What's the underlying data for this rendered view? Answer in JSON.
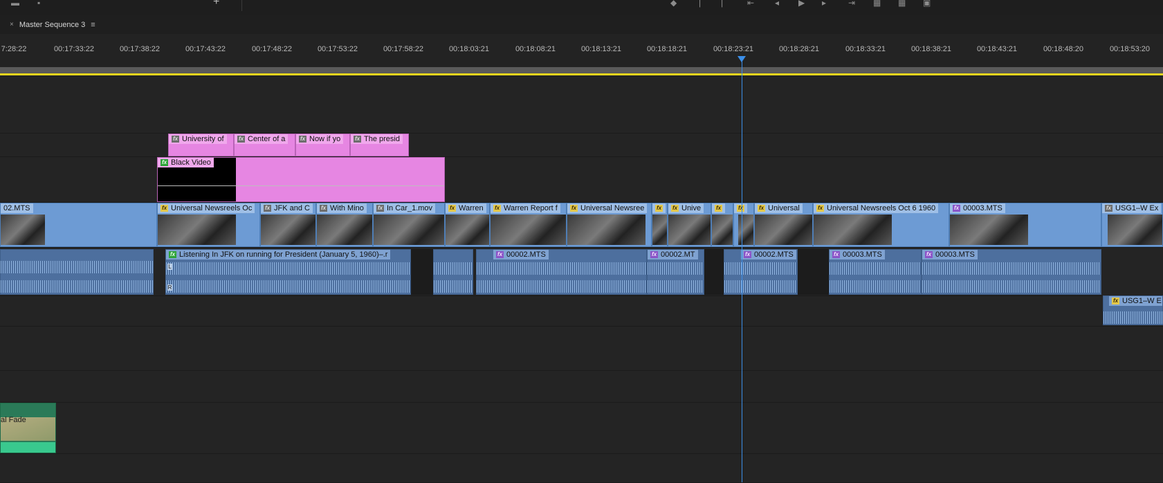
{
  "sequence_tab": {
    "close": "×",
    "title": "Master Sequence 3",
    "menu": "≡"
  },
  "toolbar": {
    "add": "+"
  },
  "ruler": {
    "timecodes": [
      "7:28:22",
      "00:17:33:22",
      "00:17:38:22",
      "00:17:43:22",
      "00:17:48:22",
      "00:17:53:22",
      "00:17:58:22",
      "00:18:03:21",
      "00:18:08:21",
      "00:18:13:21",
      "00:18:18:21",
      "00:18:23:21",
      "00:18:28:21",
      "00:18:33:21",
      "00:18:38:21",
      "00:18:43:21",
      "00:18:48:20",
      "00:18:53:20"
    ]
  },
  "title_clips": [
    "University of",
    "Center of a",
    "Now if yo",
    "The presid"
  ],
  "black_video": {
    "label": "Black Video"
  },
  "video_clips": [
    "02.MTS",
    "Universal Newsreels Oc",
    "JFK and C",
    "With Mino",
    "In Car_1.mov",
    "Warren",
    "Warren Report f",
    "Universal Newsree",
    "Unive",
    "Universal",
    "Universal Newsreels Oct 6 1960",
    "00003.MTS",
    "USG1–W Ex"
  ],
  "audio_clips": [
    "Listening In JFK on running for President (January 5, 1960)–.r",
    "00002.MTS",
    "00002.MT",
    "00002.MTS",
    "00003.MTS",
    "00003.MTS",
    "USG1–W E"
  ],
  "audio_channel": {
    "left": "L",
    "right": "R"
  },
  "fade_clip": {
    "label": "al Fade"
  }
}
